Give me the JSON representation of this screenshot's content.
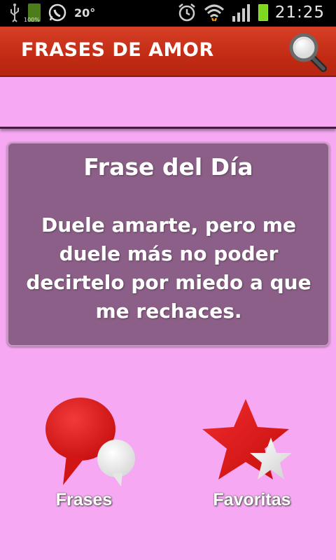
{
  "status_bar": {
    "battery_small_label": "100%",
    "temperature": "20°",
    "time": "21:25"
  },
  "app_bar": {
    "title": "FRASES DE AMOR",
    "search_icon": "magnifier-icon"
  },
  "quote_card": {
    "title": "Frase del Día",
    "text": "Duele amarte, pero me duele más no poder decirtelo por miedo a que me rechaces."
  },
  "menu": {
    "frases_label": "Frases",
    "favoritas_label": "Favoritas"
  },
  "colors": {
    "app_bar": "#c22b14",
    "background": "#f6a8f2",
    "card": "#8b5f87",
    "accent_red": "#e21a1a"
  }
}
